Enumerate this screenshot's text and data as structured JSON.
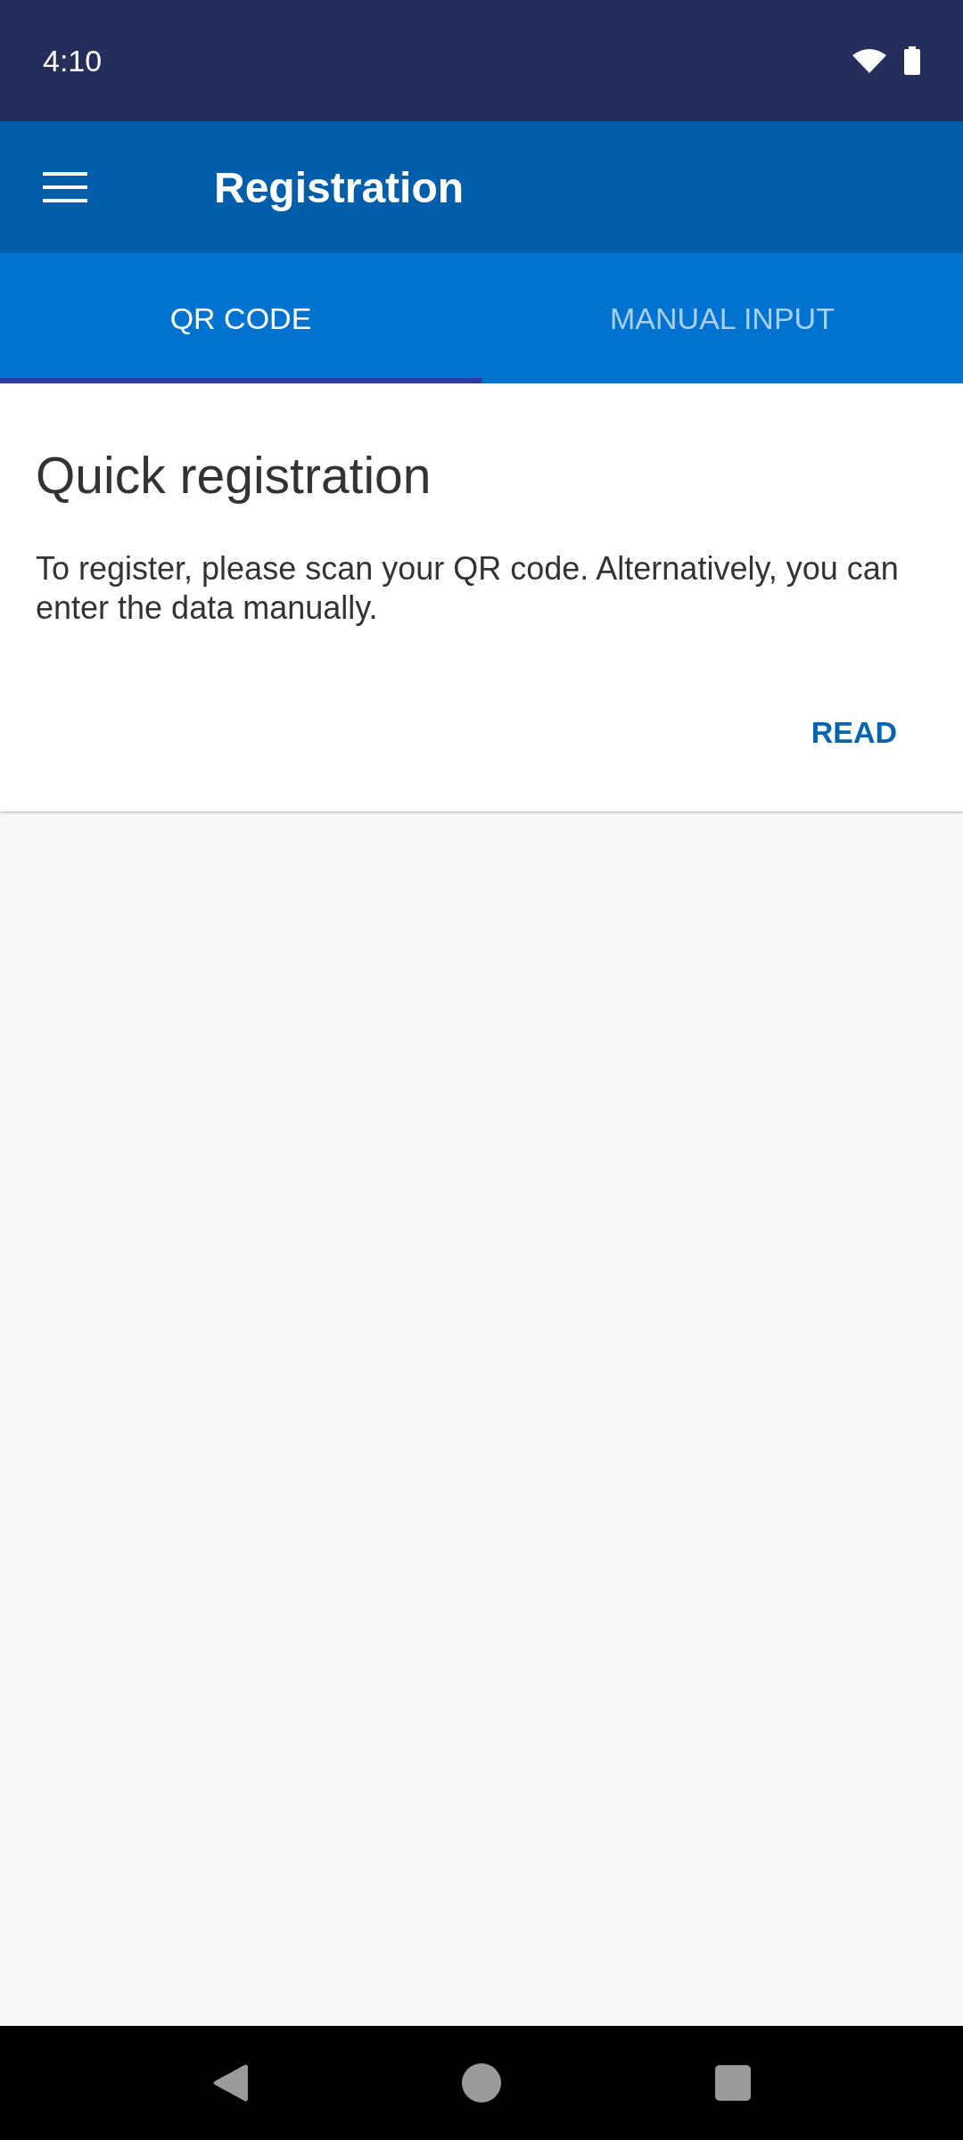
{
  "status_bar": {
    "time": "4:10"
  },
  "app_bar": {
    "title": "Registration"
  },
  "tabs": [
    {
      "label": "QR CODE",
      "selected": true
    },
    {
      "label": "MANUAL INPUT",
      "selected": false
    }
  ],
  "card": {
    "title": "Quick registration",
    "text": "To register, please scan your QR code. Alternatively, you can enter the data manually.",
    "action": "READ"
  }
}
